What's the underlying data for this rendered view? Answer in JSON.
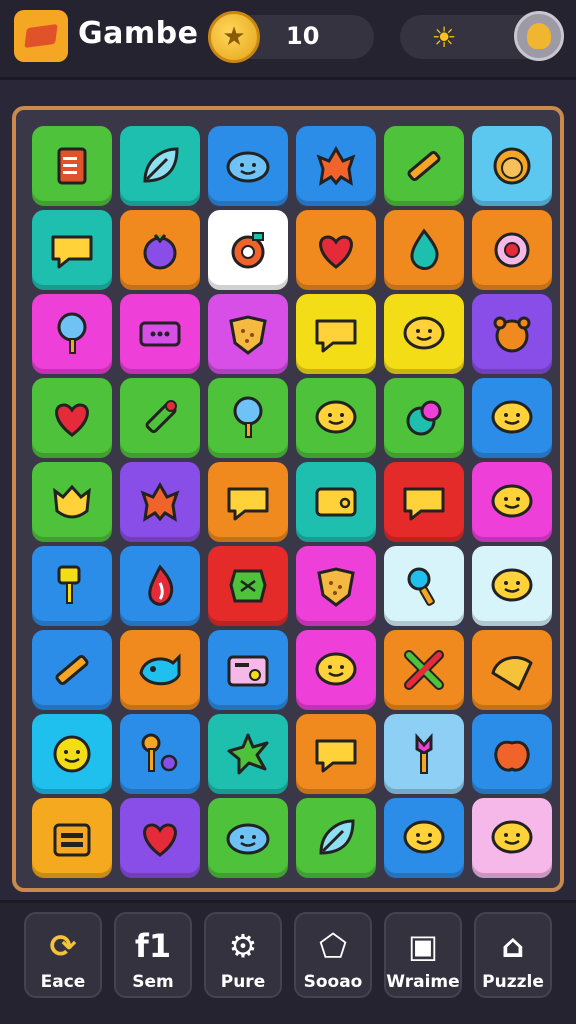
{
  "header": {
    "app_title": "Gambe",
    "coin_count": "10",
    "logo_icon": "diamond-logo-icon",
    "coin_icon": "star-coin-icon",
    "sun_icon": "sun-icon",
    "avatar_icon": "profile-avatar-icon"
  },
  "board": {
    "columns": 6,
    "rows": 9,
    "tiles": [
      {
        "color": "#4ec23a",
        "icon": "clipboard-icon"
      },
      {
        "color": "#1fbfb0",
        "icon": "leaf-icon"
      },
      {
        "color": "#2b8de8",
        "icon": "cloud-face-icon"
      },
      {
        "color": "#2b8de8",
        "icon": "creature-icon"
      },
      {
        "color": "#4ec23a",
        "icon": "pencil-icon"
      },
      {
        "color": "#5cc8f0",
        "icon": "lion-icon"
      },
      {
        "color": "#1fbfb0",
        "icon": "chat-bubble-icon"
      },
      {
        "color": "#f08a1e",
        "icon": "berry-icon"
      },
      {
        "color": "#ffffff",
        "icon": "orange-icon"
      },
      {
        "color": "#f08a1e",
        "icon": "heart-icon"
      },
      {
        "color": "#f08a1e",
        "icon": "drop-icon"
      },
      {
        "color": "#f08a1e",
        "icon": "flower-icon"
      },
      {
        "color": "#ee3fd8",
        "icon": "lollipop-icon"
      },
      {
        "color": "#ee3fd8",
        "icon": "ticket-icon"
      },
      {
        "color": "#d84fe8",
        "icon": "cookie-icon"
      },
      {
        "color": "#f2dd16",
        "icon": "chat-bubble-icon"
      },
      {
        "color": "#f2dd16",
        "icon": "smile-bubble-icon"
      },
      {
        "color": "#8a4ee8",
        "icon": "bear-icon"
      },
      {
        "color": "#4ec23a",
        "icon": "heart-icon"
      },
      {
        "color": "#4ec23a",
        "icon": "marker-icon"
      },
      {
        "color": "#4ec23a",
        "icon": "lollipop-icon"
      },
      {
        "color": "#4ec23a",
        "icon": "smile-bubble-icon"
      },
      {
        "color": "#4ec23a",
        "icon": "rose-icon"
      },
      {
        "color": "#2b8de8",
        "icon": "smile-bubble-icon"
      },
      {
        "color": "#4ec23a",
        "icon": "cat-icon"
      },
      {
        "color": "#8a4ee8",
        "icon": "creature-icon"
      },
      {
        "color": "#f08a1e",
        "icon": "chat-bubble-icon"
      },
      {
        "color": "#1fbfb0",
        "icon": "wallet-icon"
      },
      {
        "color": "#e52a2a",
        "icon": "chat-bubble-icon"
      },
      {
        "color": "#ee3fd8",
        "icon": "smile-bubble-icon"
      },
      {
        "color": "#2b8de8",
        "icon": "key-icon"
      },
      {
        "color": "#2b8de8",
        "icon": "flame-icon"
      },
      {
        "color": "#e52a2a",
        "icon": "bandage-icon"
      },
      {
        "color": "#ee3fd8",
        "icon": "cookie-icon"
      },
      {
        "color": "#d6f4fa",
        "icon": "brush-icon"
      },
      {
        "color": "#d6f4fa",
        "icon": "smile-bubble-icon"
      },
      {
        "color": "#2b8de8",
        "icon": "pencil-icon"
      },
      {
        "color": "#f08a1e",
        "icon": "whale-icon"
      },
      {
        "color": "#2b8de8",
        "icon": "radio-icon"
      },
      {
        "color": "#ee3fd8",
        "icon": "smile-bubble-icon"
      },
      {
        "color": "#f08a1e",
        "icon": "cross-icon"
      },
      {
        "color": "#f08a1e",
        "icon": "umbrella-icon"
      },
      {
        "color": "#1fbfee",
        "icon": "face-icon"
      },
      {
        "color": "#2b8de8",
        "icon": "pin-icon"
      },
      {
        "color": "#1fbfb0",
        "icon": "splat-icon"
      },
      {
        "color": "#f08a1e",
        "icon": "chat-bubble-icon"
      },
      {
        "color": "#8ecff5",
        "icon": "wand-icon"
      },
      {
        "color": "#2b8de8",
        "icon": "apple-icon"
      },
      {
        "color": "#f5a91e",
        "icon": "robot-icon"
      },
      {
        "color": "#8a4ee8",
        "icon": "heart-icon"
      },
      {
        "color": "#4ec23a",
        "icon": "cloud-face-icon"
      },
      {
        "color": "#4ec23a",
        "icon": "leaf-icon"
      },
      {
        "color": "#2b8de8",
        "icon": "smile-bubble-icon"
      },
      {
        "color": "#f5b8e8",
        "icon": "smile-bubble-icon"
      }
    ]
  },
  "nav": {
    "items": [
      {
        "label": "Eace",
        "icon": "refresh-icon"
      },
      {
        "label": "Sem",
        "icon": "f1-icon"
      },
      {
        "label": "Pure",
        "icon": "gear-icon"
      },
      {
        "label": "Sooao",
        "icon": "pentagon-icon"
      },
      {
        "label": "Wraime",
        "icon": "camera-icon"
      },
      {
        "label": "Puzzle",
        "icon": "home-icon"
      }
    ]
  },
  "colors": {
    "background": "#2a2838",
    "board_border": "#c98a4b",
    "accent_gold": "#f5a623"
  }
}
